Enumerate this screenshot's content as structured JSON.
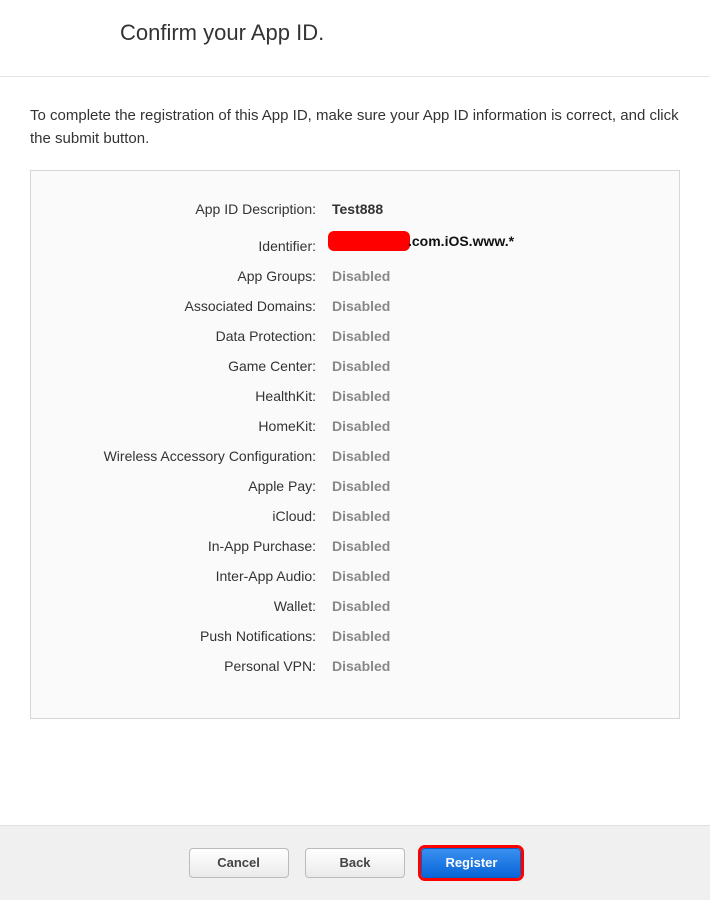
{
  "header": {
    "title": "Confirm your App ID."
  },
  "intro": "To complete the registration of this App ID, make sure your App ID information is correct, and click the submit button.",
  "details": {
    "appIdDescription": {
      "label": "App ID Description:",
      "value": "Test888"
    },
    "identifier": {
      "label": "Identifier:",
      "suffix": ".com.iOS.www.*"
    }
  },
  "capabilities": [
    {
      "label": "App Groups:",
      "value": "Disabled"
    },
    {
      "label": "Associated Domains:",
      "value": "Disabled"
    },
    {
      "label": "Data Protection:",
      "value": "Disabled"
    },
    {
      "label": "Game Center:",
      "value": "Disabled"
    },
    {
      "label": "HealthKit:",
      "value": "Disabled"
    },
    {
      "label": "HomeKit:",
      "value": "Disabled"
    },
    {
      "label": "Wireless Accessory Configuration:",
      "value": "Disabled"
    },
    {
      "label": "Apple Pay:",
      "value": "Disabled"
    },
    {
      "label": "iCloud:",
      "value": "Disabled"
    },
    {
      "label": "In-App Purchase:",
      "value": "Disabled"
    },
    {
      "label": "Inter-App Audio:",
      "value": "Disabled"
    },
    {
      "label": "Wallet:",
      "value": "Disabled"
    },
    {
      "label": "Push Notifications:",
      "value": "Disabled"
    },
    {
      "label": "Personal VPN:",
      "value": "Disabled"
    }
  ],
  "footer": {
    "cancel": "Cancel",
    "back": "Back",
    "register": "Register"
  }
}
